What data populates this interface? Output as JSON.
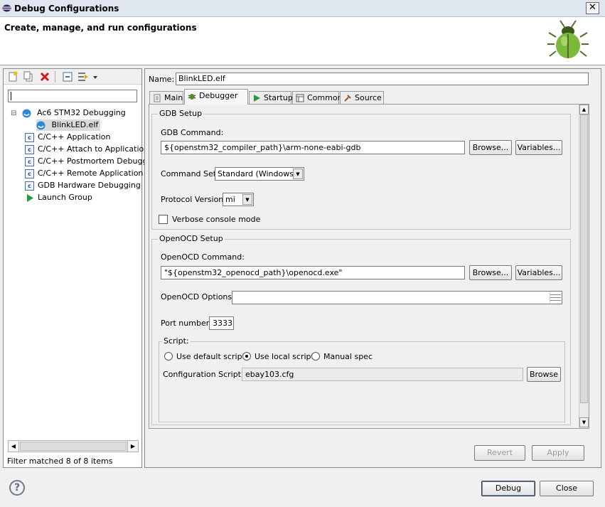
{
  "window": {
    "title": "Debug Configurations",
    "close_glyph": "✕"
  },
  "banner": {
    "heading": "Create, manage, and run configurations"
  },
  "left": {
    "filter": {
      "value": "",
      "placeholder": ""
    },
    "tree": [
      {
        "label": "Ac6 STM32 Debugging",
        "icon": "ac6-debug-icon",
        "expander": "⊟"
      },
      {
        "label": "BlinkLED.elf",
        "icon": "ac6-config-icon",
        "selected": true
      },
      {
        "label": "C/C++ Application",
        "icon": "c-icon"
      },
      {
        "label": "C/C++ Attach to Application",
        "icon": "c-icon"
      },
      {
        "label": "C/C++ Postmortem Debugge",
        "icon": "c-icon"
      },
      {
        "label": "C/C++ Remote Application",
        "icon": "c-icon"
      },
      {
        "label": "GDB Hardware Debugging",
        "icon": "c-icon"
      },
      {
        "label": "Launch Group",
        "icon": "launch-group-icon"
      }
    ],
    "c_glyph": "c",
    "scroll_left": "◀",
    "scroll_right": "▶",
    "status": "Filter matched 8 of 8 items"
  },
  "right": {
    "name_label": "Name:",
    "name_value": "BlinkLED.elf",
    "tabs": [
      {
        "label": "Main",
        "icon": "main-tab-icon"
      },
      {
        "label": "Debugger",
        "icon": "debugger-tab-icon",
        "active": true
      },
      {
        "label": "Startup",
        "icon": "startup-tab-icon"
      },
      {
        "label": "Common",
        "icon": "common-tab-icon"
      },
      {
        "label": "Source",
        "icon": "source-tab-icon"
      }
    ],
    "gdb": {
      "title": "GDB Setup",
      "command_label": "GDB Command:",
      "command_value": "${openstm32_compiler_path}\\arm-none-eabi-gdb",
      "browse": "Browse...",
      "variables": "Variables...",
      "commandset_label": "Command Set:",
      "commandset_value": "Standard (Windows)",
      "protocol_label": "Protocol Version:",
      "protocol_value": "mi",
      "verbose_label": "Verbose console mode"
    },
    "openocd": {
      "title": "OpenOCD Setup",
      "command_label": "OpenOCD Command:",
      "command_value": "\"${openstm32_openocd_path}\\openocd.exe\"",
      "browse": "Browse...",
      "variables": "Variables...",
      "options_label": "OpenOCD Options :",
      "options_value": "",
      "port_label": "Port number:",
      "port_value": "3333",
      "script": {
        "title": "Script:",
        "opt_default": "Use default script",
        "opt_local": "Use local script",
        "opt_manual": "Manual spec",
        "config_label": "Configuration Script:",
        "config_value": "ebay103.cfg",
        "browse": "Browse"
      }
    },
    "revert": "Revert",
    "apply": "Apply"
  },
  "footer": {
    "help_glyph": "?",
    "debug": "Debug",
    "close": "Close"
  },
  "scroll_up": "▲",
  "scroll_down": "▼",
  "dropdown_arrow": "▼"
}
